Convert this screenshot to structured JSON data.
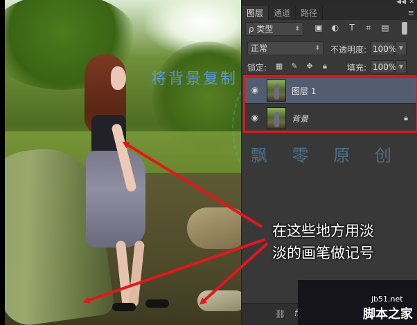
{
  "photo": {
    "overlay_copy_text": "将背景复制",
    "watermark_seal_text": "飘 零 原 创",
    "annotation_lines": [
      "在这些地方用淡",
      "淡的画笔做记号"
    ]
  },
  "panel": {
    "tabs": [
      {
        "label": "图层",
        "active": true
      },
      {
        "label": "通道",
        "active": false
      },
      {
        "label": "路径",
        "active": false
      }
    ],
    "filter": {
      "label": "ρ 类型",
      "icons": [
        "image-filter-icon",
        "adjustment-filter-icon",
        "type-filter-icon",
        "shape-filter-icon",
        "smart-object-filter-icon"
      ]
    },
    "blend_mode": "正常",
    "opacity_label": "不透明度:",
    "opacity_value": "100%",
    "lock_label": "锁定:",
    "fill_label": "填充:",
    "fill_value": "100%",
    "layers": [
      {
        "name": "图层 1",
        "selected": true,
        "visible": true,
        "locked": false
      },
      {
        "name": "背景",
        "selected": false,
        "visible": true,
        "locked": true
      }
    ],
    "bottom_icons": [
      "link-icon",
      "fx-icon"
    ]
  },
  "site_watermark": {
    "url": "jb51.net",
    "name": "脚本之家"
  },
  "colors": {
    "highlight_box": "#e4161c",
    "arrow": "#e4161c",
    "selected_layer": "#525d72"
  }
}
